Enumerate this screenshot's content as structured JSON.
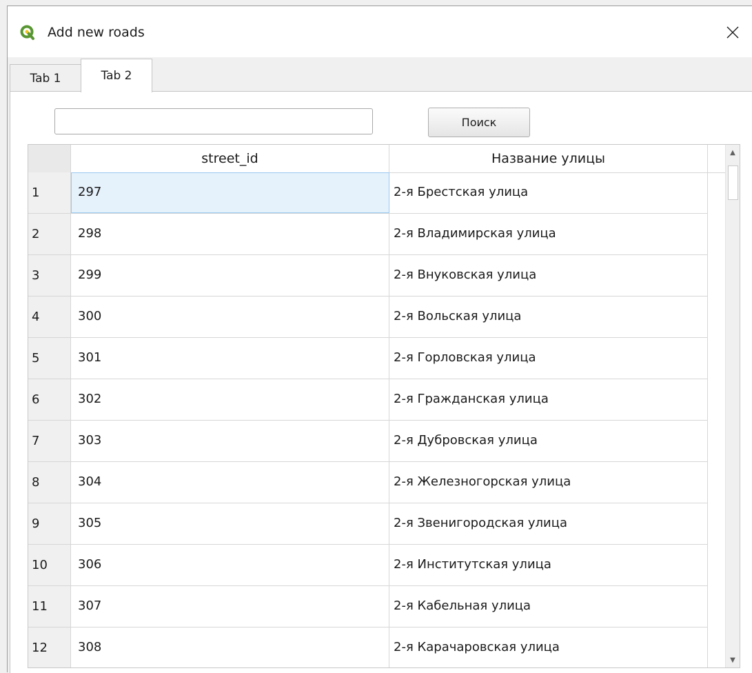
{
  "window": {
    "title": "Add new roads",
    "close_glyph": "✕",
    "icon": "qgis-logo-icon"
  },
  "tabs": [
    {
      "label": "Tab 1",
      "active": false
    },
    {
      "label": "Tab 2",
      "active": true
    }
  ],
  "search": {
    "value": "",
    "button_label": "Поиск"
  },
  "table": {
    "columns": [
      "street_id",
      "Название улицы"
    ],
    "rows": [
      {
        "num": "1",
        "street_id": "297",
        "name": "2-я Брестская улица"
      },
      {
        "num": "2",
        "street_id": "298",
        "name": "2-я Владимирская улица"
      },
      {
        "num": "3",
        "street_id": "299",
        "name": "2-я Внуковская улица"
      },
      {
        "num": "4",
        "street_id": "300",
        "name": "2-я Вольская улица"
      },
      {
        "num": "5",
        "street_id": "301",
        "name": "2-я Горловская улица"
      },
      {
        "num": "6",
        "street_id": "302",
        "name": "2-я Гражданская улица"
      },
      {
        "num": "7",
        "street_id": "303",
        "name": "2-я Дубровская улица"
      },
      {
        "num": "8",
        "street_id": "304",
        "name": "2-я Железногорская улица"
      },
      {
        "num": "9",
        "street_id": "305",
        "name": "2-я Звенигородская улица"
      },
      {
        "num": "10",
        "street_id": "306",
        "name": "2-я Институтская улица"
      },
      {
        "num": "11",
        "street_id": "307",
        "name": "2-я Кабельная улица"
      },
      {
        "num": "12",
        "street_id": "308",
        "name": "2-я Карачаровская улица"
      }
    ],
    "selected_row": 0
  },
  "colors": {
    "qgis_green": "#589632",
    "qgis_yellow": "#ee7913",
    "selection": "#e5f1fb"
  }
}
